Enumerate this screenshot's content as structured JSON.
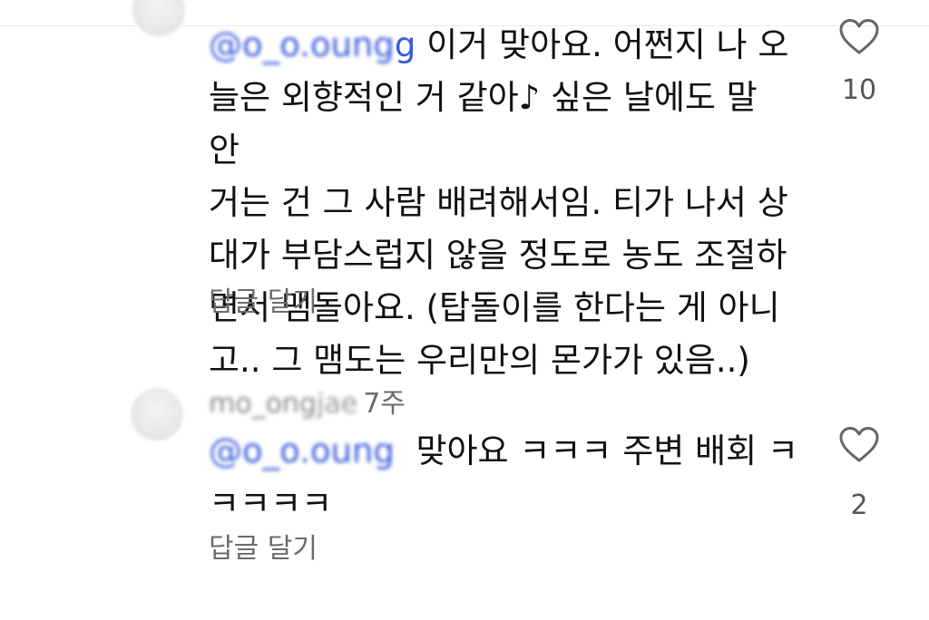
{
  "comments": [
    {
      "mention_blur": "@o_o.oung",
      "mention_tail": "g",
      "text": " 이거 맞아요. 어쩐지 나 오\n늘은 외향적인 거 같아♪ 싶은 날에도 말 안\n거는 건 그 사람 배려해서임. 티가 나서 상\n대가 부담스럽지 않을 정도로 농도 조절하\n면서 맴돌아요. (탑돌이를 한다는 게 아니\n고.. 그 맴도는 우리만의 몬가가 있음..)",
      "reply_label": "답글 달기",
      "like_count": "10"
    },
    {
      "username_blur": "mo_ong",
      "username_tail": "jae",
      "time": "7주",
      "mention_blur": "@o_o.oung",
      "text": "  맞아요 ㅋㅋㅋ 주변 배회 ㅋ\nㅋㅋㅋㅋ",
      "reply_label": "답글 달기",
      "like_count": "2"
    }
  ],
  "colors": {
    "mention": "#3b5bdb",
    "secondary_text": "#6b6b6b",
    "primary_text": "#111111"
  },
  "icons": {
    "like": "heart-outline-icon"
  }
}
